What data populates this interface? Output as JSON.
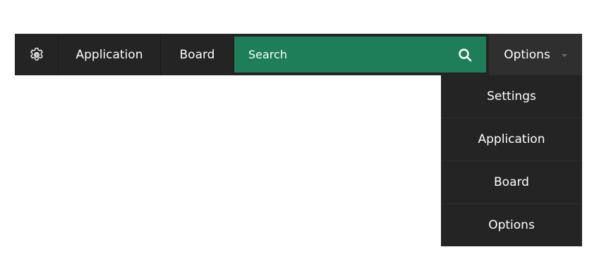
{
  "navbar": {
    "settings_icon": "gear-icon",
    "items": [
      {
        "label": "Application"
      },
      {
        "label": "Board"
      }
    ],
    "search": {
      "placeholder": "Search",
      "icon": "search-icon"
    },
    "options": {
      "label": "Options",
      "icon": "chevron-down-icon"
    }
  },
  "dropdown": {
    "items": [
      {
        "label": "Settings"
      },
      {
        "label": "Application"
      },
      {
        "label": "Board"
      },
      {
        "label": "Options"
      }
    ]
  },
  "colors": {
    "navbar_bg": "#242424",
    "search_bg": "#1e7e5a",
    "options_bg": "#2f2f2f",
    "text": "#ffffff"
  }
}
